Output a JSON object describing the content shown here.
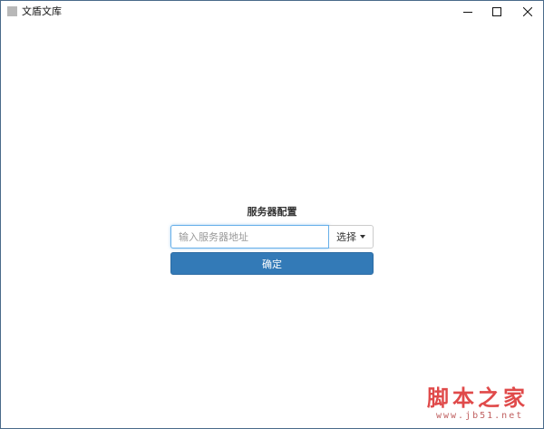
{
  "window": {
    "title": "文盾文库",
    "icons": {
      "app": "app-icon",
      "minimize": "minimize-icon",
      "maximize": "maximize-icon",
      "close": "close-icon"
    }
  },
  "config": {
    "title": "服务器配置",
    "server_input": {
      "value": "",
      "placeholder": "输入服务器地址"
    },
    "select_label": "选择",
    "select_icon": "caret-down-icon",
    "confirm_label": "确定"
  },
  "watermark": {
    "chinese": "脚本之家",
    "url": "www.jb51.net"
  },
  "colors": {
    "primary": "#337ab7",
    "input_focus": "#66afe9",
    "watermark": "#e04a4a"
  }
}
